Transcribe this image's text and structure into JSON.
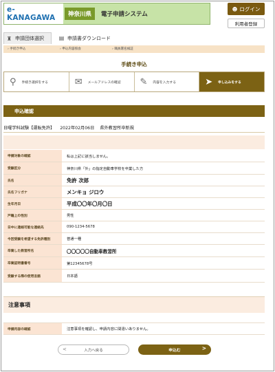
{
  "header": {
    "logo": "e-KANAGAWA",
    "prefecture": "神奈川県",
    "system_title": "電子申請システム",
    "login_label": "ログイン",
    "register_label": "利用者登録"
  },
  "tabs": [
    {
      "label": "申請団体選択"
    },
    {
      "label": "申請書ダウンロード"
    }
  ],
  "breadcrumb": [
    "手続き申込",
    "申込内容照会",
    "職員署名検証"
  ],
  "page_heading": "手続き申込",
  "steps": [
    {
      "label": "手続き選択をする",
      "icon": "search-icon"
    },
    {
      "label": "メールアドレスの確認",
      "icon": "mail-icon"
    },
    {
      "label": "内容を入力する",
      "icon": "pencil-icon"
    },
    {
      "label": "申し込みをする",
      "icon": "send-icon"
    }
  ],
  "section_title": "申込確認",
  "exam_info": {
    "name": "日曜学科試験【運転免許】",
    "date": "2022年02月06日",
    "place": "県外教習所卒新規"
  },
  "rows": [
    {
      "label": "申請対象の確認",
      "value": "私は上記に該当しません。"
    },
    {
      "label": "受験区分",
      "value": "神奈川県「外」の指定自動車学校を卒業した方"
    },
    {
      "label": "氏名",
      "value": "免許 次郎"
    },
    {
      "label": "氏名フリガナ",
      "value": "メンキョ ジロウ"
    },
    {
      "label": "生年月日",
      "value": "平成〇〇年〇月〇日"
    },
    {
      "label": "戸籍上の性別",
      "value": "男性"
    },
    {
      "label": "日中に連絡可能な連絡先",
      "value": "090-1234-5678"
    },
    {
      "label": "今回受験を希望する免許種別",
      "value": "普通一種"
    },
    {
      "label": "卒業した教習所名",
      "value": "〇〇〇〇〇自動車教習所"
    },
    {
      "label": "卒業証明書番号",
      "value": "第12345678号"
    },
    {
      "label": "受験する際の使用言語",
      "value": "日本語"
    }
  ],
  "notice": {
    "title": "注意事項",
    "row_label": "申請内容の確認",
    "row_value": "注意事項を確認し、申請内容に間違いありません。"
  },
  "buttons": {
    "back": "入力へ戻る",
    "submit": "申込む"
  }
}
